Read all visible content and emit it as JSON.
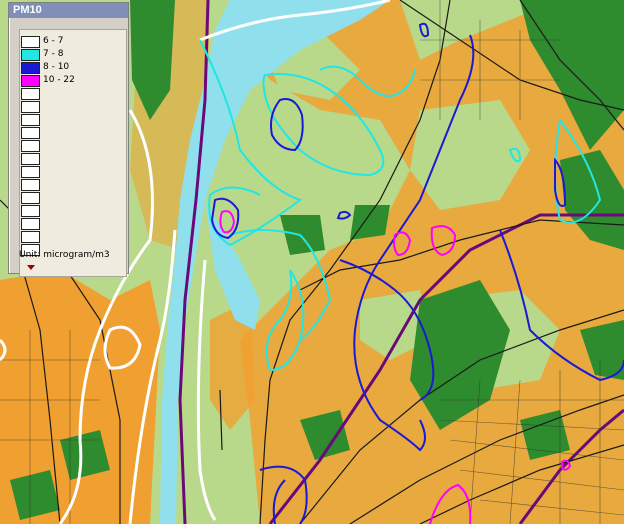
{
  "legend": {
    "title": "PM10",
    "unit_label": "Unit: microgram/m3",
    "classes": [
      {
        "label": "6 - 7",
        "color": "#ffffff"
      },
      {
        "label": "7 - 8",
        "color": "#22e5e5"
      },
      {
        "label": "8 - 10",
        "color": "#1a1ad6"
      },
      {
        "label": "10 - 22",
        "color": "#ff00ff"
      },
      {
        "label": "",
        "color": "#ffffff"
      },
      {
        "label": "",
        "color": "#ffffff"
      },
      {
        "label": "",
        "color": "#ffffff"
      },
      {
        "label": "",
        "color": "#ffffff"
      },
      {
        "label": "",
        "color": "#ffffff"
      },
      {
        "label": "",
        "color": "#ffffff"
      },
      {
        "label": "",
        "color": "#ffffff"
      },
      {
        "label": "",
        "color": "#ffffff"
      },
      {
        "label": "",
        "color": "#ffffff"
      },
      {
        "label": "",
        "color": "#ffffff"
      },
      {
        "label": "",
        "color": "#ffffff"
      },
      {
        "label": "",
        "color": "#ffffff"
      },
      {
        "label": "",
        "color": "#ffffff"
      }
    ]
  },
  "map_colors": {
    "water": "#8fe0ec",
    "green_space": "#b9d98a",
    "forest": "#2e8b2e",
    "urban": "#f0a030",
    "river_line": "#6a0a7a"
  }
}
